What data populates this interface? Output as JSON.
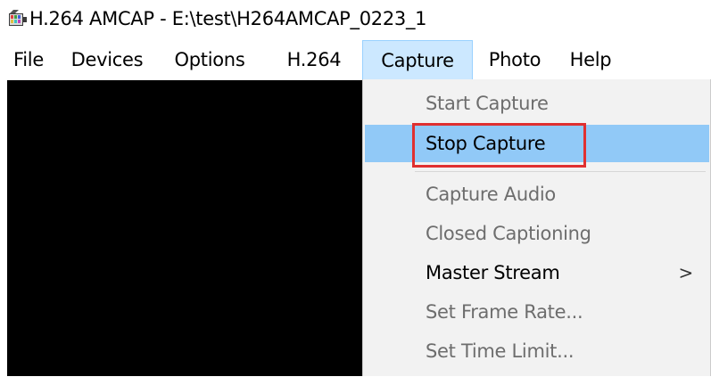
{
  "window": {
    "title": "H.264 AMCAP - E:\\test\\H264AMCAP_0223_1",
    "icon": "amcap-app-icon"
  },
  "menubar": {
    "items": [
      {
        "label": "File"
      },
      {
        "label": "Devices"
      },
      {
        "label": "Options"
      },
      {
        "label": "H.264"
      },
      {
        "label": "Capture"
      },
      {
        "label": "Photo"
      },
      {
        "label": "Help"
      }
    ],
    "active": "Capture"
  },
  "capture_menu": {
    "items": [
      {
        "label": "Start Capture",
        "state": "disabled"
      },
      {
        "label": "Stop Capture",
        "state": "highlighted"
      },
      {
        "label": "Capture Audio",
        "state": "disabled"
      },
      {
        "label": "Closed Captioning",
        "state": "disabled"
      },
      {
        "label": "Master Stream",
        "state": "enabled",
        "submenu_arrow": ">"
      },
      {
        "label": "Set Frame Rate...",
        "state": "disabled"
      },
      {
        "label": "Set Time Limit...",
        "state": "disabled"
      }
    ]
  },
  "colors": {
    "highlight": "#91c9f7",
    "active_menu": "#cce8ff",
    "annotation_box": "#e03030",
    "video_bg": "#000000"
  }
}
